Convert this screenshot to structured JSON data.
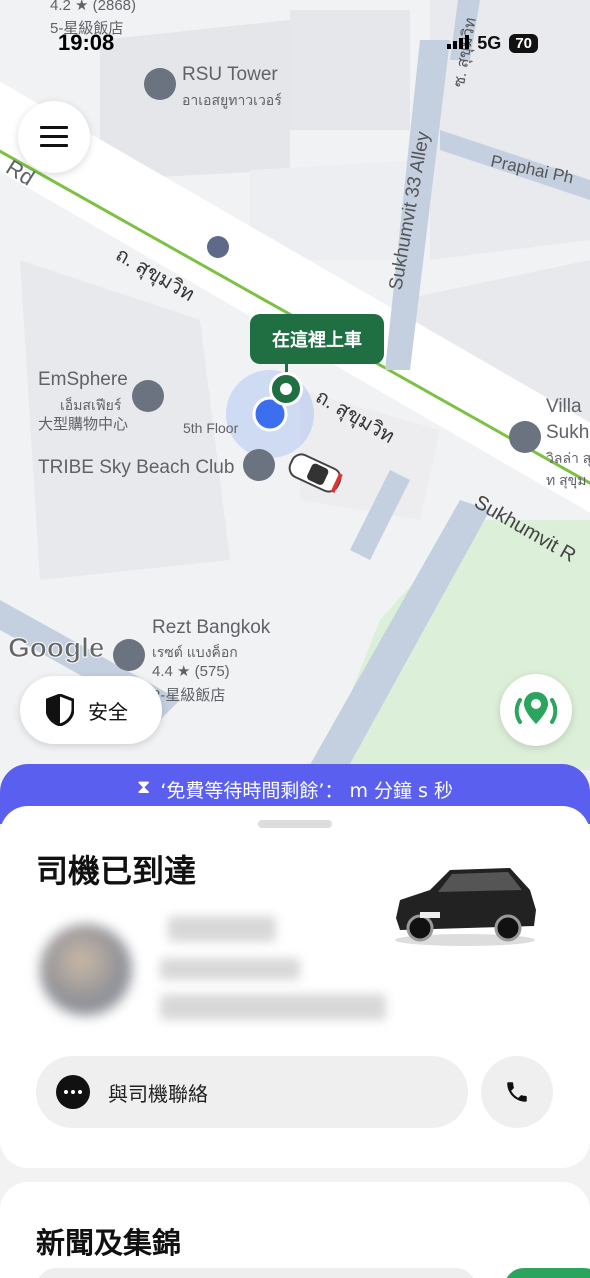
{
  "status_bar": {
    "time": "19:08",
    "network": "5G",
    "battery": "70"
  },
  "map": {
    "roads": {
      "rd_top_left": "Rd",
      "sukhumvit_thai_1": "ถ. สุขุมวิท",
      "sukhumvit_thai_2": "ถ. สุขุมวิท",
      "sukhumvit_en": "Sukhumvit R",
      "alley": "Sukhumvit 33 Alley",
      "alley_thai": "ซ. สุขุมวิท",
      "praphai": "Praphai Ph"
    },
    "places": {
      "top_rating": "4.2 ★ (2868)",
      "top_class": "5-星級飯店",
      "rsu_name": "RSU Tower",
      "rsu_thai": "อาเอสยูทาวเวอร์",
      "emsphere_name": "EmSphere",
      "emsphere_thai": "เอ็มสเฟียร์",
      "emsphere_type": "大型購物中心",
      "fifth_floor": "5th Floor",
      "tribe": "TRIBE Sky Beach Club",
      "rezt_name": "Rezt Bangkok",
      "rezt_thai": "เรซต์ แบงค็อก",
      "rezt_rating": "4.4 ★ (575)",
      "rezt_class": "2-星級飯店",
      "villa_1": "Villa",
      "villa_2": "Sukh",
      "villa_3": "วิลล่า สุ",
      "villa_4": "ท สุขุม"
    },
    "pickup_label": "在這裡上車",
    "google": "Google",
    "safety_label": "安全"
  },
  "wait_banner": {
    "text": "‘免費等待時間剩餘’： m 分鐘 s 秒"
  },
  "sheet": {
    "title": "司機已到達",
    "contact_label": "與司機聯絡"
  },
  "news": {
    "title": "新聞及集錦"
  },
  "colors": {
    "accent_green": "#1f6f43",
    "banner_purple": "#5a5ff0",
    "route_green": "#7cc242"
  }
}
